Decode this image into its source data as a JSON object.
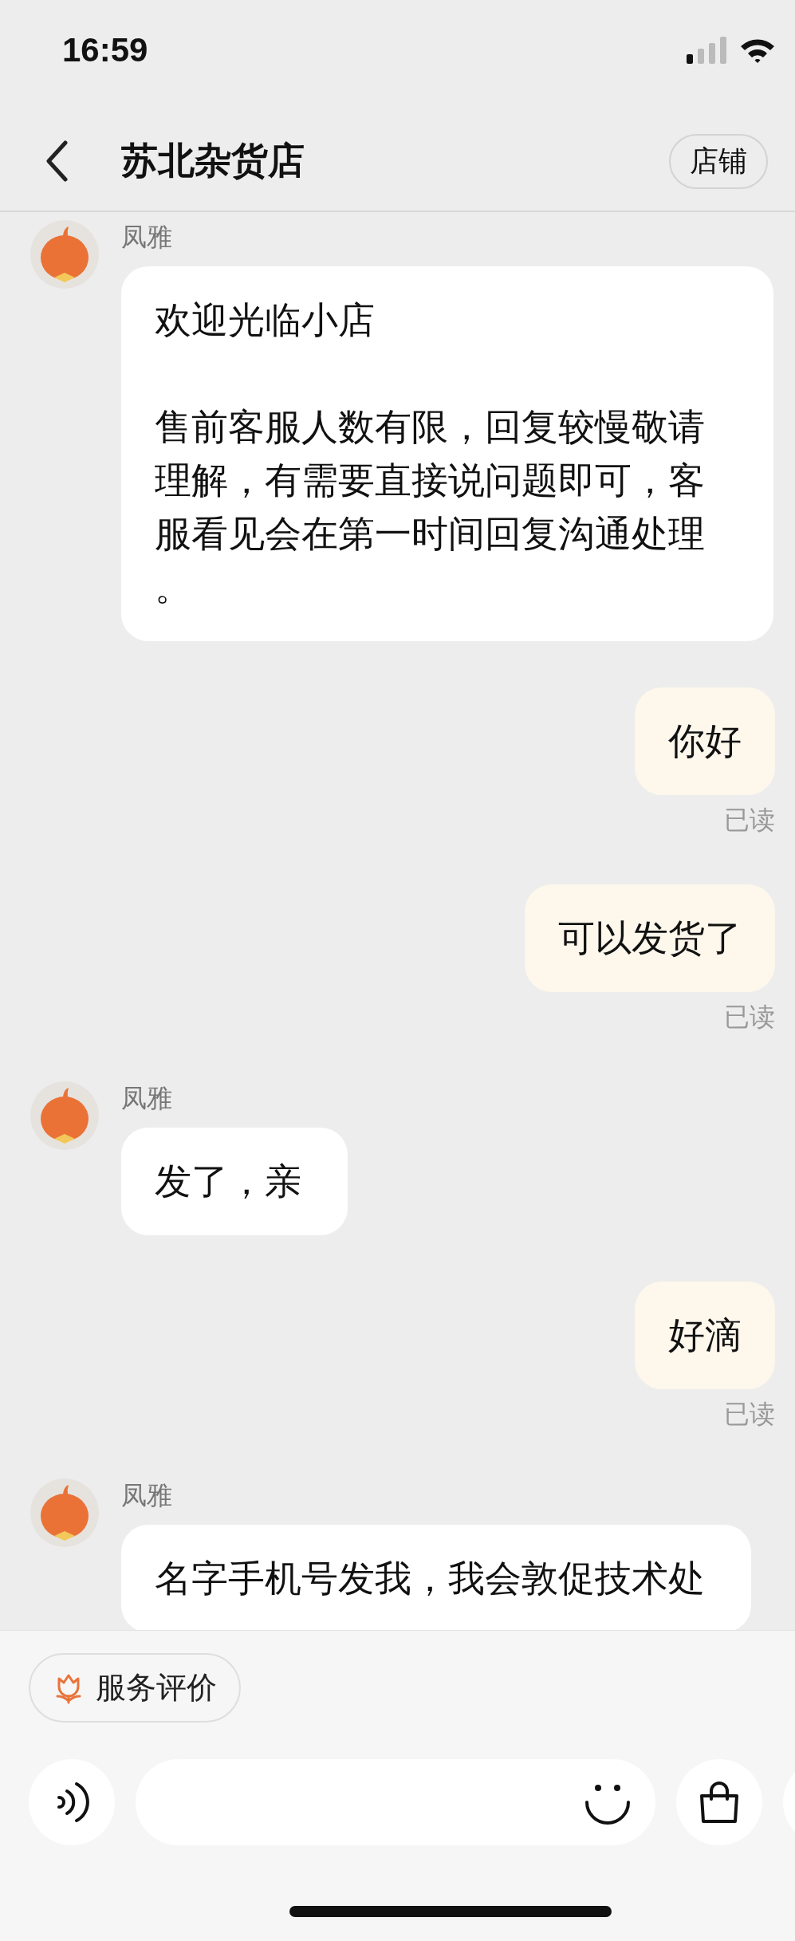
{
  "status_bar": {
    "time": "16:59"
  },
  "nav": {
    "title": "苏北杂货店",
    "shop_button": "店铺"
  },
  "messages": [
    {
      "kind": "received",
      "sender": "凤雅",
      "paragraphs": [
        "欢迎光临小店",
        "售前客服人数有限，回复较慢敬请理解，有需要直接说问题即可，客服看见会在第一时间回复沟通处理。"
      ]
    },
    {
      "kind": "sent",
      "text": "你好",
      "status": "已读"
    },
    {
      "kind": "sent",
      "text": "可以发货了",
      "status": "已读"
    },
    {
      "kind": "received",
      "sender": "凤雅",
      "paragraphs": [
        "发了，亲"
      ]
    },
    {
      "kind": "sent",
      "text": "好滴",
      "status": "已读"
    },
    {
      "kind": "received",
      "sender": "凤雅",
      "paragraphs": [
        "名字手机号发我，我会敦促技术处"
      ]
    }
  ],
  "rating_button": "服务评价"
}
